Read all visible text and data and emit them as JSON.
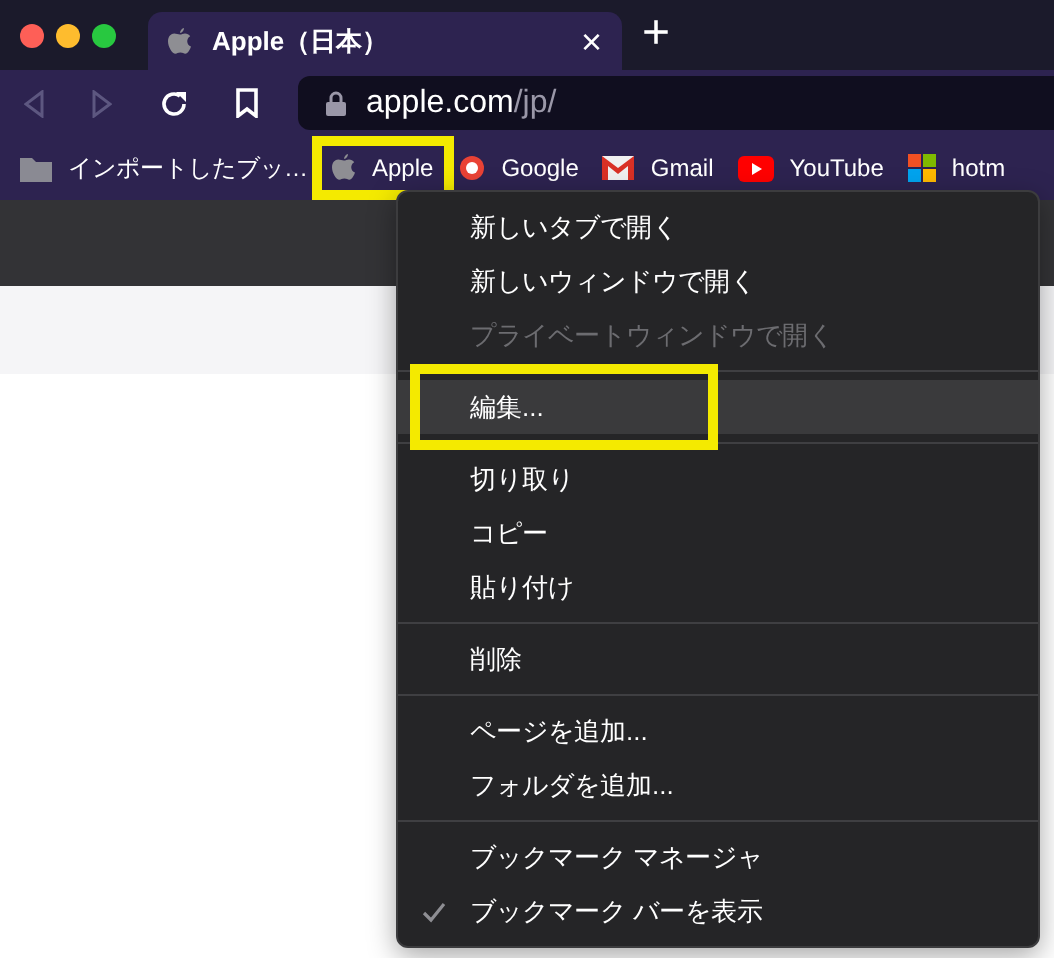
{
  "tab": {
    "title": "Apple（日本）",
    "close": "×",
    "selected": true
  },
  "new_tab": "+",
  "address": {
    "host": "apple.com",
    "path": "/jp/"
  },
  "bookmarks": [
    {
      "kind": "folder",
      "label": "インポートしたブッ…",
      "highlighted": false
    },
    {
      "kind": "apple",
      "label": "Apple",
      "highlighted": true
    },
    {
      "kind": "google",
      "label": "Google",
      "highlighted": false
    },
    {
      "kind": "gmail",
      "label": "Gmail",
      "highlighted": false
    },
    {
      "kind": "youtube",
      "label": "YouTube",
      "highlighted": false
    },
    {
      "kind": "microsoft",
      "label": "hotm",
      "highlighted": false
    }
  ],
  "menu": [
    {
      "kind": "item",
      "label": "新しいタブで開く",
      "disabled": false,
      "selected": false,
      "checked": false,
      "highlighted": false
    },
    {
      "kind": "item",
      "label": "新しいウィンドウで開く",
      "disabled": false,
      "selected": false,
      "checked": false,
      "highlighted": false
    },
    {
      "kind": "item",
      "label": "プライベートウィンドウで開く",
      "disabled": true,
      "selected": false,
      "checked": false,
      "highlighted": false
    },
    {
      "kind": "separator"
    },
    {
      "kind": "item",
      "label": "編集...",
      "disabled": false,
      "selected": true,
      "checked": false,
      "highlighted": true
    },
    {
      "kind": "separator"
    },
    {
      "kind": "item",
      "label": "切り取り",
      "disabled": false,
      "selected": false,
      "checked": false,
      "highlighted": false
    },
    {
      "kind": "item",
      "label": "コピー",
      "disabled": false,
      "selected": false,
      "checked": false,
      "highlighted": false
    },
    {
      "kind": "item",
      "label": "貼り付け",
      "disabled": false,
      "selected": false,
      "checked": false,
      "highlighted": false
    },
    {
      "kind": "separator"
    },
    {
      "kind": "item",
      "label": "削除",
      "disabled": false,
      "selected": false,
      "checked": false,
      "highlighted": false
    },
    {
      "kind": "separator"
    },
    {
      "kind": "item",
      "label": "ページを追加...",
      "disabled": false,
      "selected": false,
      "checked": false,
      "highlighted": false
    },
    {
      "kind": "item",
      "label": "フォルダを追加...",
      "disabled": false,
      "selected": false,
      "checked": false,
      "highlighted": false
    },
    {
      "kind": "separator"
    },
    {
      "kind": "item",
      "label": "ブックマーク マネージャ",
      "disabled": false,
      "selected": false,
      "checked": false,
      "highlighted": false
    },
    {
      "kind": "item",
      "label": "ブックマーク バーを表示",
      "disabled": false,
      "selected": false,
      "checked": true,
      "highlighted": false
    }
  ]
}
